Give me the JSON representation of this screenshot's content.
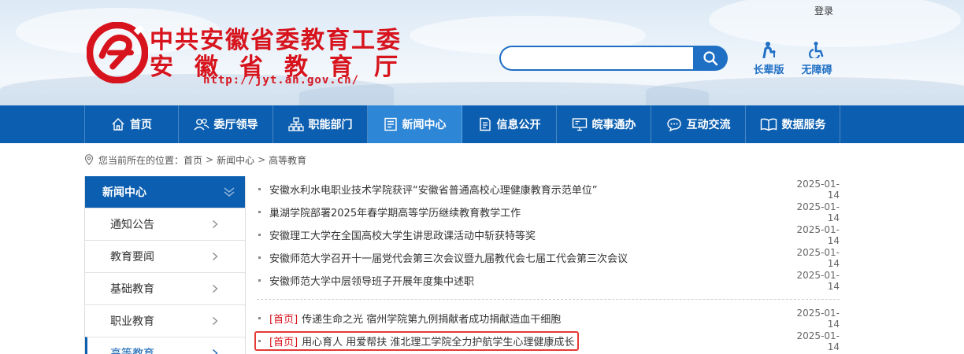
{
  "header": {
    "login_label": "登录",
    "logo": {
      "line1": "中共安徽省委教育工委",
      "line2": "安徽省教育厅",
      "url": "http://jyt.ah.gov.cn/"
    },
    "search": {
      "placeholder": "",
      "value": ""
    },
    "tools": [
      {
        "label": "长辈版",
        "icon": "elder-icon"
      },
      {
        "label": "无障碍",
        "icon": "accessibility-icon"
      }
    ]
  },
  "nav": {
    "items": [
      {
        "label": "首页",
        "icon": "home-icon"
      },
      {
        "label": "委厅领导",
        "icon": "leaders-icon"
      },
      {
        "label": "职能部门",
        "icon": "org-chart-icon"
      },
      {
        "label": "新闻中心",
        "icon": "news-icon",
        "active": true
      },
      {
        "label": "信息公开",
        "icon": "document-icon"
      },
      {
        "label": "皖事通办",
        "icon": "monitor-icon"
      },
      {
        "label": "互动交流",
        "icon": "chat-icon"
      },
      {
        "label": "数据服务",
        "icon": "book-icon"
      }
    ]
  },
  "breadcrumb": {
    "prefix": "您当前所在的位置：",
    "items": [
      "首页",
      "新闻中心",
      "高等教育"
    ],
    "separator": ">"
  },
  "sidebar": {
    "heading": "新闻中心",
    "items": [
      {
        "label": "通知公告"
      },
      {
        "label": "教育要闻"
      },
      {
        "label": "基础教育"
      },
      {
        "label": "职业教育"
      },
      {
        "label": "高等教育",
        "active": true
      }
    ]
  },
  "news": {
    "group1": [
      {
        "title": "安徽水利水电职业技术学院获评“安徽省普通高校心理健康教育示范单位”",
        "date": "2025-01-14"
      },
      {
        "title": "巢湖学院部署2025年春学期高等学历继续教育教学工作",
        "date": "2025-01-14"
      },
      {
        "title": "安徽理工大学在全国高校大学生讲思政课活动中斩获特等奖",
        "date": "2025-01-14"
      },
      {
        "title": "安徽师范大学召开十一届党代会第三次会议暨九届教代会七届工代会第三次会议",
        "date": "2025-01-14"
      },
      {
        "title": "安徽师范大学中层领导班子开展年度集中述职",
        "date": "2025-01-14"
      }
    ],
    "group2": [
      {
        "tag": "[首页]",
        "title": "传递生命之光 宿州学院第九例捐献者成功捐献造血干细胞",
        "date": "2025-01-14"
      },
      {
        "tag": "[首页]",
        "title": "用心育人 用爱帮扶 淮北理工学院全力护航学生心理健康成长",
        "date": "2025-01-14"
      }
    ]
  },
  "colors": {
    "brand_blue": "#0c5fb0",
    "active_blue": "#2e86d6",
    "logo_red": "#d7141d",
    "highlight_red": "#e53935"
  }
}
